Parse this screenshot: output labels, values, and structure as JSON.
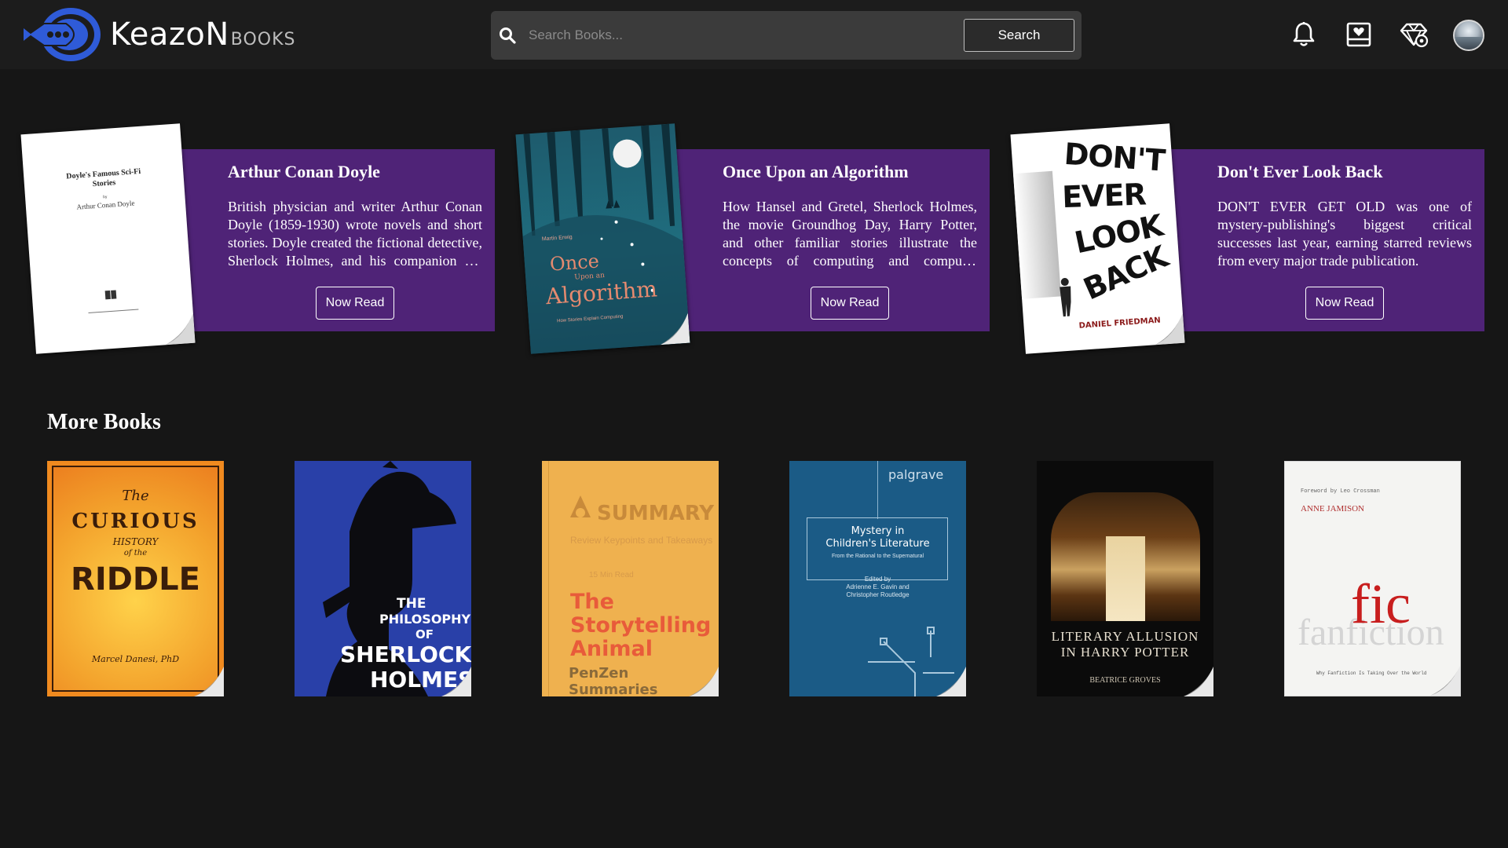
{
  "header": {
    "logo_main": "KeazoN",
    "logo_sub": "BOOKS",
    "search_placeholder": "Search Books...",
    "search_button": "Search"
  },
  "featured": [
    {
      "title": "Arthur Conan Doyle",
      "description": "British physician and writer Arthur Conan Doyle (1859-1930) wrote novels and short stories. Doyle created the fictional detective, Sherlock Holmes, and his companion Dr. Watson.",
      "button": "Now Read",
      "cover": {
        "title": "Doyle's Famous Sci-Fi Stories",
        "author": "Arthur Conan Doyle"
      }
    },
    {
      "title": "Once Upon an Algorithm",
      "description": "How Hansel and Gretel, Sherlock Holmes, the movie Groundhog Day, Harry Potter, and other familiar stories illustrate the concepts of computing and computer science.",
      "button": "Now Read",
      "cover": {
        "author": "Martin Erwig",
        "title_line1": "Once",
        "title_line2": "Upon an",
        "title_line3": "Algorithm",
        "subtitle": "How Stories Explain Computing"
      }
    },
    {
      "title": "Don't Ever Look Back",
      "description": "DON'T EVER GET OLD was one of mystery-publishing's biggest critical successes last year, earning starred reviews from every major trade publication.",
      "button": "Now Read",
      "cover": {
        "w1": "DON'T",
        "w2": "EVER",
        "w3": "LOOK",
        "w4": "BACK",
        "author": "DANIEL FRIEDMAN"
      }
    }
  ],
  "more_books": {
    "title": "More Books",
    "items": [
      {
        "t1": "The",
        "t2": "CURIOUS",
        "t3": "HISTORY",
        "t4": "of the",
        "t5": "RIDDLE",
        "author": "Marcel Danesi, PhD"
      },
      {
        "t1": "THE",
        "t2": "PHILOSOPHY",
        "t3": "OF",
        "t4": "SHERLOCK",
        "t5": "HOLMES"
      },
      {
        "t1": "SUMMARY",
        "t2": "Review Keypoints and Takeaways",
        "t3": "15 Min Read",
        "t4": "The",
        "t5": "Storytelling",
        "t6": "Animal",
        "t7": "PenZen Summaries"
      },
      {
        "publisher": "palgrave",
        "t1": "Mystery in",
        "t2": "Children's Literature",
        "t3": "From the Rational to the Supernatural",
        "t4": "Edited by",
        "t5": "Adrienne E. Gavin and",
        "t6": "Christopher Routledge"
      },
      {
        "t1": "LITERARY ALLUSION",
        "t2": "IN HARRY POTTER",
        "author": "BEATRICE GROVES"
      },
      {
        "foreword": "Foreword by Leo Crossman",
        "author": "ANNE JAMISON",
        "t1": "fic",
        "t2": "fanfiction",
        "t3": "Why Fanfiction Is Taking Over the World"
      }
    ]
  },
  "colors": {
    "background": "#161616",
    "header": "#1c1c1c",
    "panel": "#4f2377",
    "logo_blue": "#2f5bd8"
  }
}
